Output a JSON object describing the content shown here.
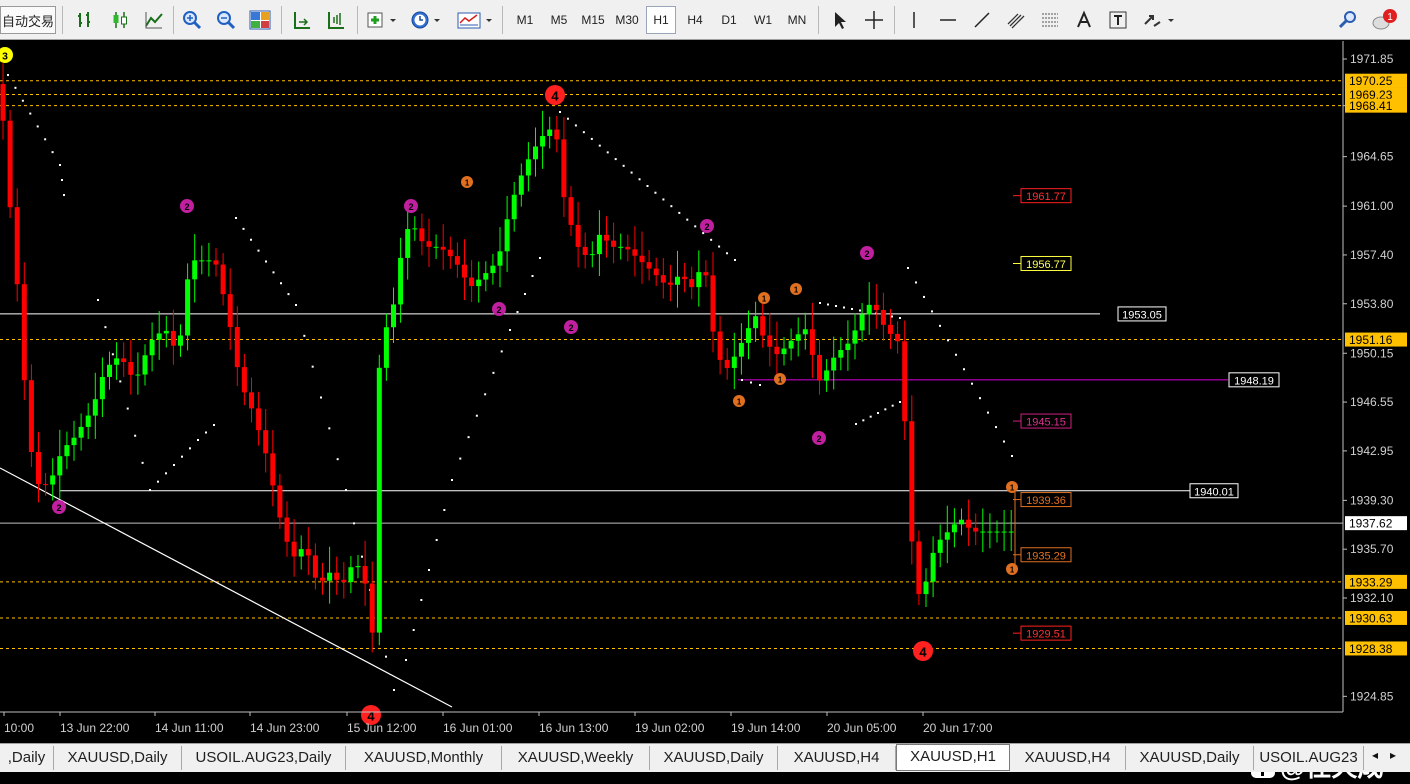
{
  "toolbar": {
    "autotrade_label": "自动交易",
    "timeframes": [
      "M1",
      "M5",
      "M15",
      "M30",
      "H1",
      "H4",
      "D1",
      "W1",
      "MN"
    ],
    "active_timeframe": "H1",
    "notification_count": "1"
  },
  "chart": {
    "symbol": "XAUUSD",
    "timeframe": "H1",
    "current_price": "1937.62",
    "price_ticks": [
      "1971.85",
      "1968.41",
      "1964.65",
      "1961.00",
      "1957.40",
      "1953.80",
      "1950.15",
      "1946.55",
      "1942.95",
      "1939.30",
      "1935.70",
      "1932.10",
      "1924.85"
    ],
    "time_ticks": [
      "10:00",
      "13 Jun 22:00",
      "14 Jun 11:00",
      "14 Jun 23:00",
      "15 Jun 12:00",
      "16 Jun 01:00",
      "16 Jun 13:00",
      "19 Jun 02:00",
      "19 Jun 14:00",
      "20 Jun 05:00",
      "20 Jun 17:00"
    ],
    "axis_price_labels_gold": [
      "1970.25",
      "1969.23",
      "1968.41",
      "1951.16",
      "1933.29",
      "1930.63",
      "1928.38"
    ],
    "levels_white": [
      "1953.05",
      "1940.01"
    ],
    "level_magenta": "1948.19",
    "projection_labels": {
      "red": "1961.77",
      "yellow": "1956.77",
      "pink": "1945.15",
      "orange_upper": "1939.36",
      "orange_lower": "1935.29",
      "red_lower": "1929.51"
    },
    "wave_markers": {
      "top_left": "3",
      "peak": "4",
      "trough": "4",
      "bottom": "4",
      "minor": "2",
      "small": "1"
    },
    "colors": {
      "bull": "#00ff00",
      "bear": "#ff0000",
      "gold_line": "#ffc000",
      "magenta": "#c000c0",
      "background": "#000000"
    }
  },
  "tabs": {
    "items": [
      ",Daily",
      "XAUUSD,Daily",
      "USOIL.AUG23,Daily",
      "XAUUSD,Monthly",
      "XAUUSD,Weekly",
      "XAUUSD,Daily",
      "XAUUSD,H4",
      "XAUUSD,H1",
      "XAUUSD,H4",
      "XAUUSD,Daily",
      "USOIL.AUG23"
    ],
    "active_index": 7
  },
  "watermark": "@任天成"
}
